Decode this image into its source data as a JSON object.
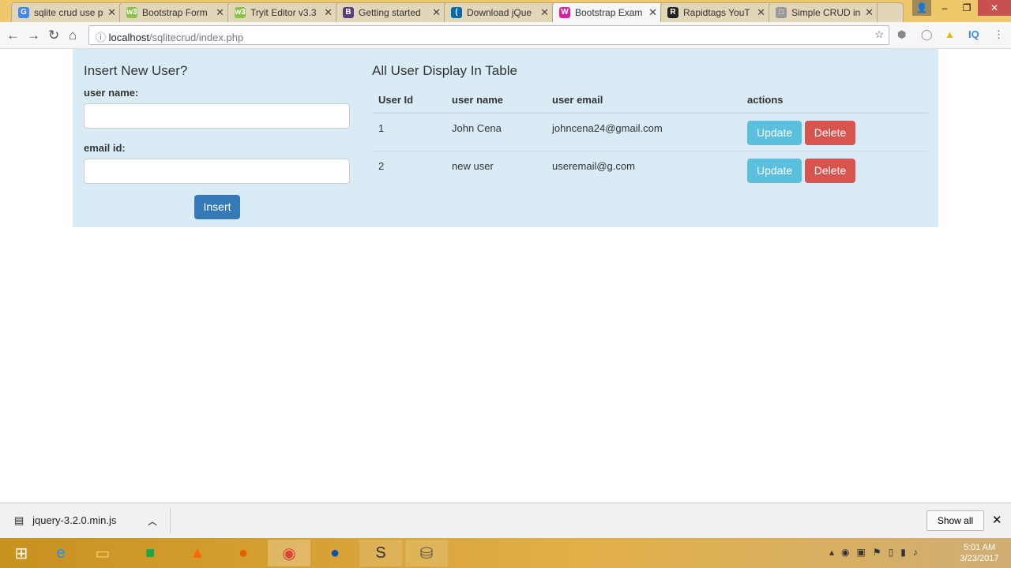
{
  "browser": {
    "tabs": [
      {
        "title": "sqlite crud use p",
        "icon": "google-icon",
        "color": "#4285f4",
        "glyph": "G"
      },
      {
        "title": "Bootstrap Form",
        "icon": "w3schools-icon",
        "color": "#8bc34a",
        "glyph": "w3"
      },
      {
        "title": "Tryit Editor v3.3",
        "icon": "w3schools-icon",
        "color": "#8bc34a",
        "glyph": "w3"
      },
      {
        "title": "Getting started",
        "icon": "bootstrap-icon",
        "color": "#563d7c",
        "glyph": "B"
      },
      {
        "title": "Download jQue",
        "icon": "jquery-icon",
        "color": "#0769ad",
        "glyph": "("
      },
      {
        "title": "Bootstrap Exam",
        "icon": "w3-icon",
        "color": "#d6249f",
        "glyph": "W"
      },
      {
        "title": "Rapidtags YouT",
        "icon": "rapidtags-icon",
        "color": "#222",
        "glyph": "R"
      },
      {
        "title": "Simple CRUD in",
        "icon": "page-icon",
        "color": "#999",
        "glyph": "□"
      }
    ],
    "url_host": "localhost",
    "url_path": "/sqlitecrud/index.php",
    "ext_iq": "IQ"
  },
  "form": {
    "title": "Insert New User?",
    "name_label": "user name:",
    "email_label": "email id:",
    "name_value": "",
    "email_value": "",
    "insert_label": "Insert"
  },
  "table": {
    "title": "All User Display In Table",
    "headers": [
      "User Id",
      "user name",
      "user email",
      "actions"
    ],
    "rows": [
      {
        "id": "1",
        "name": "John Cena",
        "email": "johncena24@gmail.com"
      },
      {
        "id": "2",
        "name": "new user",
        "email": "useremail@g.com"
      }
    ],
    "update_label": "Update",
    "delete_label": "Delete"
  },
  "downloads": {
    "file": "jquery-3.2.0.min.js",
    "show_all": "Show all"
  },
  "taskbar": {
    "time": "5:01 AM",
    "date": "3/23/2017"
  },
  "colors": {
    "panel": "#d9ebf5",
    "primary": "#337ab7",
    "info": "#5bc0de",
    "danger": "#d9534f"
  }
}
